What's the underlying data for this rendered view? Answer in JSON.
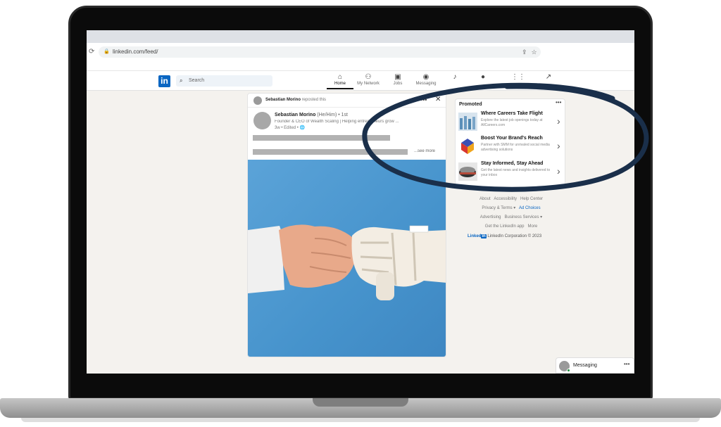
{
  "browser": {
    "url": "linkedin.com/feed/",
    "reload_icon": "reload-icon",
    "lock_icon": "lock-icon"
  },
  "nav": {
    "logo": "in",
    "search_placeholder": "Search",
    "items": [
      {
        "label": "Home",
        "icon": "home-icon",
        "active": true
      },
      {
        "label": "My Network",
        "icon": "network-icon"
      },
      {
        "label": "Jobs",
        "icon": "jobs-icon"
      },
      {
        "label": "Messaging",
        "icon": "messaging-icon"
      },
      {
        "label": "",
        "icon": "notifications-icon"
      },
      {
        "label": "",
        "icon": "me-avatar-icon"
      },
      {
        "label": "",
        "icon": "apps-grid-icon"
      },
      {
        "label": "",
        "icon": "advertise-icon"
      }
    ]
  },
  "post": {
    "repost_actor": "Sebastian Morino",
    "repost_action": "reposted this",
    "author_name": "Sebastian Morino",
    "author_pronouns_degree": "(He/Him) • 1st",
    "author_bio": "Founder & CEO of Wealth Scaling | Helping entrepreneurs grow ...",
    "author_meta": "3w • Edited •",
    "see_more": "...see more",
    "image_caption": "Human hand and robot hand fist bump"
  },
  "promoted": {
    "title": "Promoted",
    "ads": [
      {
        "title": "Where Careers Take Flight",
        "desc": "Explore the latest job openings today at AllCareers.com"
      },
      {
        "title": "Boost Your Brand's Reach",
        "desc": "Partner with SMM for unrivaled social media advertising solutions"
      },
      {
        "title": "Stay Informed, Stay Ahead",
        "desc": "Get the latest news and insights delivered to your inbox"
      }
    ]
  },
  "footer": {
    "about": "About",
    "accessibility": "Accessibility",
    "help": "Help Center",
    "privacy": "Privacy & Terms",
    "ad_choices": "Ad Choices",
    "advertising": "Advertising",
    "business": "Business Services",
    "get_app": "Get the LinkedIn app",
    "more": "More",
    "brand": "Linked",
    "copyright": "LinkedIn Corporation © 2023"
  },
  "messaging": {
    "label": "Messaging"
  },
  "colors": {
    "linkedin_blue": "#0a66c2",
    "annotation_ink": "#1a2f4a"
  }
}
